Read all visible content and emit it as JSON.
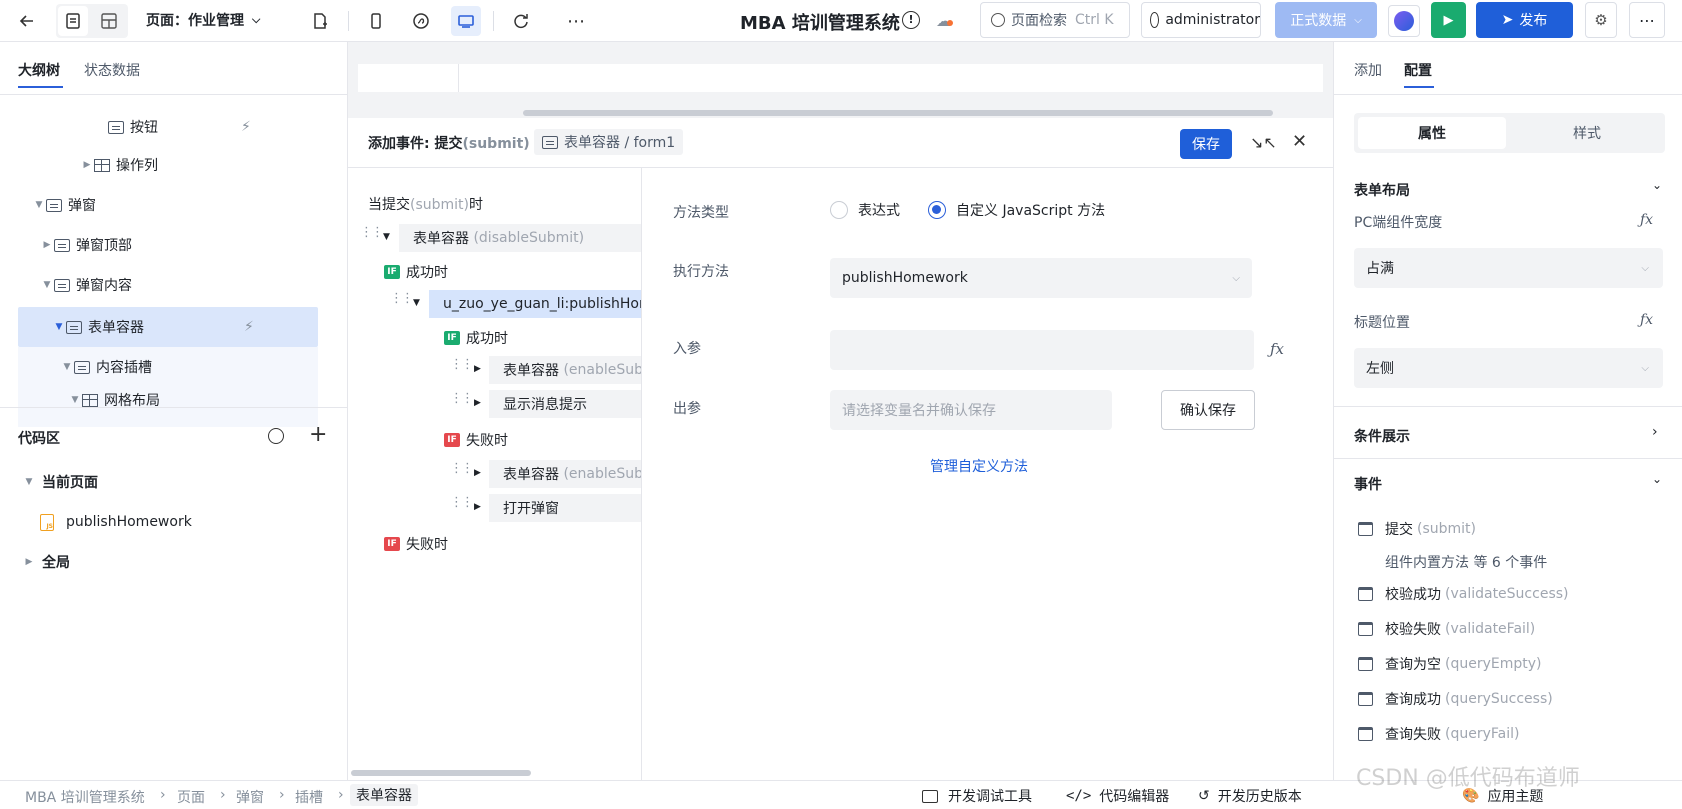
{
  "topbar": {
    "page_label": "页面：作业管理",
    "app_title": "MBA 培训管理系统",
    "search_placeholder": "页面检索",
    "search_shortcut": "Ctrl K",
    "user": "administrator",
    "env_label": "正式数据",
    "publish_label": "发布"
  },
  "left": {
    "tabs": [
      "大纲树",
      "状态数据"
    ],
    "tree": [
      {
        "label": "按钮"
      },
      {
        "label": "操作列"
      },
      {
        "label": "弹窗"
      },
      {
        "label": "弹窗顶部"
      },
      {
        "label": "弹窗内容"
      },
      {
        "label": "表单容器"
      },
      {
        "label": "内容插槽"
      },
      {
        "label": "网格布局"
      }
    ],
    "code_area": {
      "title": "代码区",
      "current_page": "当前页面",
      "method": "publishHomework",
      "global": "全局"
    }
  },
  "event": {
    "title": "添加事件: 提交",
    "title_suffix": "(submit)",
    "target": "表单容器 / form1",
    "save_label": "保存",
    "trigger_prefix": "当提交",
    "trigger_event": "(submit)",
    "trigger_suffix": "时",
    "nodes": {
      "disable": {
        "label": "表单容器",
        "detail": "(disableSubmit)"
      },
      "success1": "成功时",
      "method_call": "u_zuo_ye_guan_li:publishHom",
      "success2": "成功时",
      "enable1": {
        "label": "表单容器",
        "detail": "(enableSub"
      },
      "toast": "显示消息提示",
      "fail2": "失败时",
      "enable2": {
        "label": "表单容器",
        "detail": "(enableSub"
      },
      "open_dialog": "打开弹窗",
      "fail1": "失败时"
    },
    "if_badge": "IF"
  },
  "form": {
    "method_type_label": "方法类型",
    "option_expr": "表达式",
    "option_js": "自定义 JavaScript 方法",
    "exec_label": "执行方法",
    "exec_value": "publishHomework",
    "input_label": "入参",
    "output_label": "出参",
    "output_placeholder": "请选择变量名并确认保存",
    "confirm_label": "确认保存",
    "manage_link": "管理自定义方法"
  },
  "right": {
    "tabs": [
      "添加",
      "配置"
    ],
    "segments": [
      "属性",
      "样式"
    ],
    "layout_title": "表单布局",
    "pc_width_label": "PC端组件宽度",
    "pc_width_value": "占满",
    "title_pos_label": "标题位置",
    "title_pos_value": "左侧",
    "cond_title": "条件展示",
    "events_title": "事件",
    "events": [
      {
        "label": "提交",
        "code": "(submit)"
      },
      {
        "label": "校验成功",
        "code": "(validateSuccess)"
      },
      {
        "label": "校验失败",
        "code": "(validateFail)"
      },
      {
        "label": "查询为空",
        "code": "(queryEmpty)"
      },
      {
        "label": "查询成功",
        "code": "(querySuccess)"
      },
      {
        "label": "查询失败",
        "code": "(queryFail)"
      }
    ],
    "builtin_events": "组件内置方法 等 6 个事件"
  },
  "bottom": {
    "breadcrumbs": [
      "MBA 培训管理系统",
      "页面",
      "弹窗",
      "插槽",
      "表单容器"
    ],
    "tools": [
      "开发调试工具",
      "代码编辑器",
      "开发历史版本",
      "应用主题"
    ],
    "watermark": "CSDN @低代码布道师"
  },
  "colors": {
    "primary": "#2b5fd9",
    "green": "#1aab6f",
    "red": "#e5484d"
  }
}
